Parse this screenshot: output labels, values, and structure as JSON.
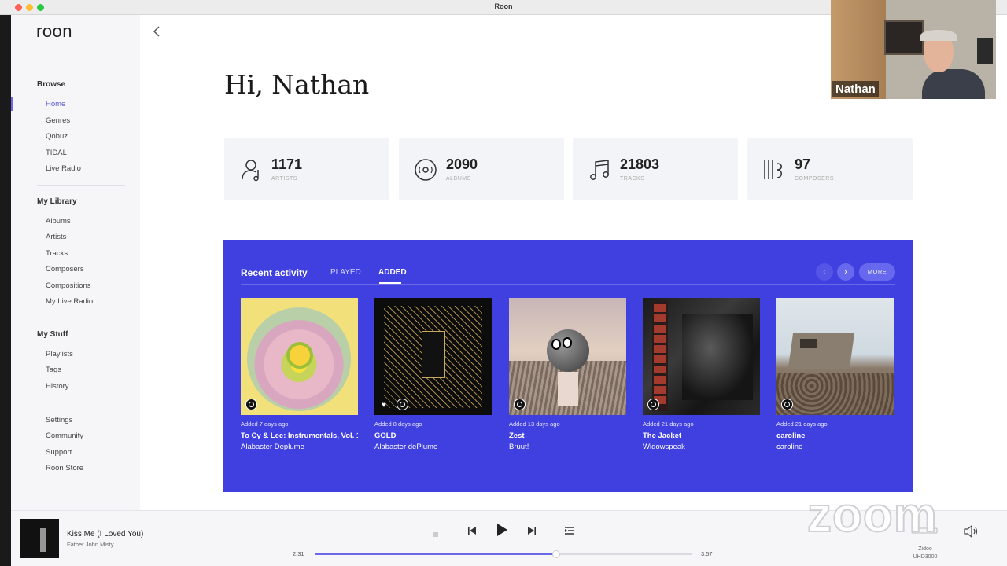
{
  "window": {
    "title": "Roon"
  },
  "sidebar": {
    "logo": "roon",
    "sections": [
      {
        "heading": "Browse",
        "items": [
          "Home",
          "Genres",
          "Qobuz",
          "TIDAL",
          "Live Radio"
        ]
      },
      {
        "heading": "My Library",
        "items": [
          "Albums",
          "Artists",
          "Tracks",
          "Composers",
          "Compositions",
          "My Live Radio"
        ]
      },
      {
        "heading": "My Stuff",
        "items": [
          "Playlists",
          "Tags",
          "History"
        ]
      }
    ],
    "footer_items": [
      "Settings",
      "Community",
      "Support",
      "Roon Store"
    ],
    "active_item": "Home"
  },
  "main": {
    "back_icon": "chevron-left-icon",
    "greeting": "Hi, Nathan",
    "stats": [
      {
        "value": "1171",
        "label": "ARTISTS",
        "icon": "artist-icon"
      },
      {
        "value": "2090",
        "label": "ALBUMS",
        "icon": "album-disc-icon"
      },
      {
        "value": "21803",
        "label": "TRACKS",
        "icon": "music-note-icon"
      },
      {
        "value": "97",
        "label": "COMPOSERS",
        "icon": "composer-icon"
      }
    ],
    "recent": {
      "title": "Recent activity",
      "tabs": [
        "PLAYED",
        "ADDED"
      ],
      "selected_tab": "ADDED",
      "more_label": "MORE",
      "albums": [
        {
          "added": "Added 7 days ago",
          "title": "To Cy & Lee: Instrumentals, Vol. 1",
          "artist": "Alabaster Deplume"
        },
        {
          "added": "Added 8 days ago",
          "title": "GOLD",
          "artist": "Alabaster dePlume"
        },
        {
          "added": "Added 13 days ago",
          "title": "Zest",
          "artist": "Bruut!"
        },
        {
          "added": "Added 21 days ago",
          "title": "The Jacket",
          "artist": "Widowspeak"
        },
        {
          "added": "Added 21 days ago",
          "title": "caroline",
          "artist": "caroline"
        }
      ],
      "accent": "#4040e0"
    }
  },
  "player": {
    "track_title": "Kiss Me (I Loved You)",
    "track_artist": "Father John Misty",
    "elapsed": "2:31",
    "duration": "3:57",
    "progress_fraction": 0.64,
    "zone_name": "Zidoo",
    "zone_model": "UHD3000"
  },
  "overlay": {
    "participant_name": "Nathan",
    "watermark": "zoom"
  }
}
